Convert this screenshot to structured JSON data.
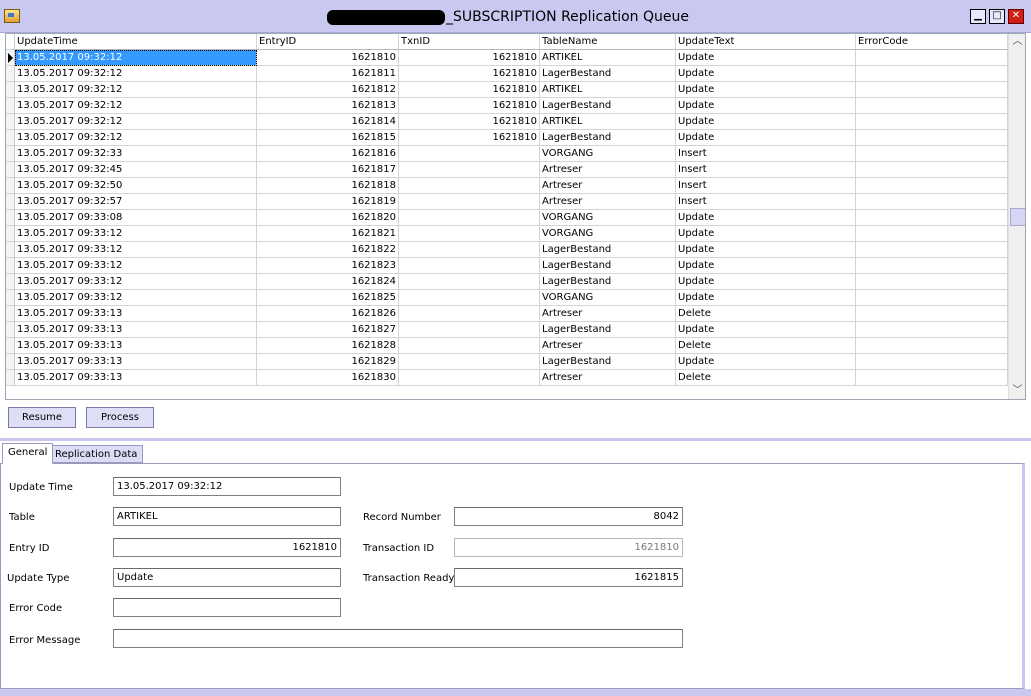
{
  "window": {
    "title": "_SUBSCRIPTION Replication Queue",
    "minimize": "▁",
    "maximize": "□",
    "close": "✕"
  },
  "grid": {
    "columns": [
      "UpdateTime",
      "EntryID",
      "TxnID",
      "TableName",
      "UpdateText",
      "ErrorCode"
    ],
    "rows": [
      [
        "13.05.2017 09:32:12",
        "1621810",
        "1621810",
        "ARTIKEL",
        "Update",
        ""
      ],
      [
        "13.05.2017 09:32:12",
        "1621811",
        "1621810",
        "LagerBestand",
        "Update",
        ""
      ],
      [
        "13.05.2017 09:32:12",
        "1621812",
        "1621810",
        "ARTIKEL",
        "Update",
        ""
      ],
      [
        "13.05.2017 09:32:12",
        "1621813",
        "1621810",
        "LagerBestand",
        "Update",
        ""
      ],
      [
        "13.05.2017 09:32:12",
        "1621814",
        "1621810",
        "ARTIKEL",
        "Update",
        ""
      ],
      [
        "13.05.2017 09:32:12",
        "1621815",
        "1621810",
        "LagerBestand",
        "Update",
        ""
      ],
      [
        "13.05.2017 09:32:33",
        "1621816",
        "",
        "VORGANG",
        "Insert",
        ""
      ],
      [
        "13.05.2017 09:32:45",
        "1621817",
        "",
        "Artreser",
        "Insert",
        ""
      ],
      [
        "13.05.2017 09:32:50",
        "1621818",
        "",
        "Artreser",
        "Insert",
        ""
      ],
      [
        "13.05.2017 09:32:57",
        "1621819",
        "",
        "Artreser",
        "Insert",
        ""
      ],
      [
        "13.05.2017 09:33:08",
        "1621820",
        "",
        "VORGANG",
        "Update",
        ""
      ],
      [
        "13.05.2017 09:33:12",
        "1621821",
        "",
        "VORGANG",
        "Update",
        ""
      ],
      [
        "13.05.2017 09:33:12",
        "1621822",
        "",
        "LagerBestand",
        "Update",
        ""
      ],
      [
        "13.05.2017 09:33:12",
        "1621823",
        "",
        "LagerBestand",
        "Update",
        ""
      ],
      [
        "13.05.2017 09:33:12",
        "1621824",
        "",
        "LagerBestand",
        "Update",
        ""
      ],
      [
        "13.05.2017 09:33:12",
        "1621825",
        "",
        "VORGANG",
        "Update",
        ""
      ],
      [
        "13.05.2017 09:33:13",
        "1621826",
        "",
        "Artreser",
        "Delete",
        ""
      ],
      [
        "13.05.2017 09:33:13",
        "1621827",
        "",
        "LagerBestand",
        "Update",
        ""
      ],
      [
        "13.05.2017 09:33:13",
        "1621828",
        "",
        "Artreser",
        "Delete",
        ""
      ],
      [
        "13.05.2017 09:33:13",
        "1621829",
        "",
        "LagerBestand",
        "Update",
        ""
      ],
      [
        "13.05.2017 09:33:13",
        "1621830",
        "",
        "Artreser",
        "Delete",
        ""
      ]
    ],
    "scroll_up": "︿",
    "scroll_down": "﹀"
  },
  "buttons": {
    "resume": "Resume",
    "process": "Process"
  },
  "tabs": [
    {
      "label": "General"
    },
    {
      "label": "Replication Data"
    }
  ],
  "form": {
    "update_time": {
      "label": "Update Time",
      "value": "13.05.2017 09:32:12"
    },
    "table": {
      "label": "Table",
      "value": "ARTIKEL"
    },
    "entry_id": {
      "label": "Entry ID",
      "value": "1621810"
    },
    "update_type": {
      "label": "Update Type",
      "value": "Update"
    },
    "error_code": {
      "label": "Error Code",
      "value": ""
    },
    "error_message": {
      "label": "Error Message",
      "value": ""
    },
    "record_number": {
      "label": "Record Number",
      "value": "8042"
    },
    "transaction_id": {
      "label": "Transaction ID",
      "value": "1621810"
    },
    "transaction_ready": {
      "label": "Transaction Ready",
      "value": "1621815"
    }
  },
  "colors": {
    "window_frame": "#c8c8f0",
    "selection": "#3399ff",
    "button_face": "#dedef6",
    "close_button": "#d02018"
  }
}
